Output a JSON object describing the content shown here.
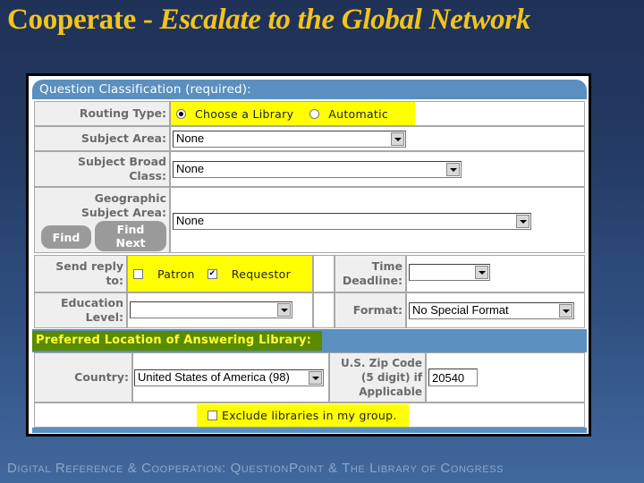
{
  "slide": {
    "title_main": "Cooperate - ",
    "title_sub": "Escalate to the Global Network",
    "footer": "Digital Reference & Cooperation: QuestionPoint & The Library of Congress"
  },
  "form": {
    "section_title": "Question Classification (required):",
    "routing_type": {
      "label": "Routing Type:",
      "options": [
        {
          "label": "Choose a Library",
          "selected": true
        },
        {
          "label": "Automatic",
          "selected": false
        }
      ]
    },
    "subject_area": {
      "label": "Subject Area:",
      "value": "None"
    },
    "subject_broad_class": {
      "label_line1": "Subject Broad",
      "label_line2": "Class:",
      "value": "None"
    },
    "geographic_subject_area": {
      "label_line1": "Geographic",
      "label_line2": "Subject Area:",
      "value": "None",
      "find_button": "Find",
      "find_next_line1": "Find",
      "find_next_line2": "Next"
    },
    "send_reply_to": {
      "label_line1": "Send reply",
      "label_line2": "to:",
      "options": [
        {
          "label": "Patron",
          "checked": false
        },
        {
          "label": "Requestor",
          "checked": true
        }
      ]
    },
    "time_deadline": {
      "label_line1": "Time",
      "label_line2": "Deadline:",
      "value": ""
    },
    "education_level": {
      "label_line1": "Education",
      "label_line2": "Level:",
      "value": ""
    },
    "format": {
      "label": "Format:",
      "value": "No Special Format"
    },
    "preferred_location_title": "Preferred Location of Answering Library:",
    "country": {
      "label": "Country:",
      "value": "United States of America (98)"
    },
    "zip_code": {
      "label_line1": "U.S. Zip Code",
      "label_line2": "(5 digit) if",
      "label_line3": "Applicable",
      "value": "20540"
    },
    "exclude_group": {
      "label": "Exclude libraries in my group.",
      "checked": false
    }
  }
}
